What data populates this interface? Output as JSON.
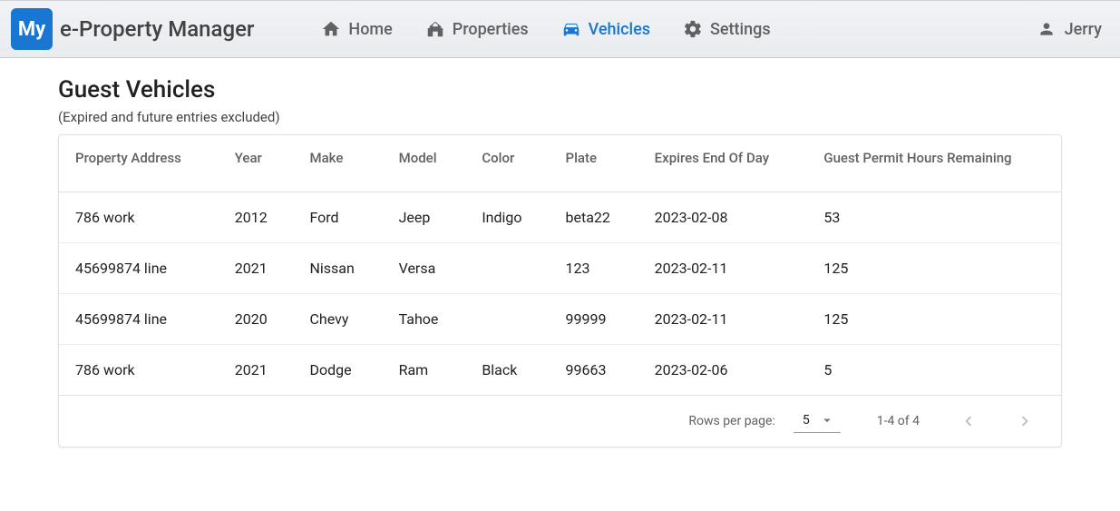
{
  "brand": {
    "logo_text": "My",
    "name": "e-Property Manager"
  },
  "nav": {
    "home": "Home",
    "properties": "Properties",
    "vehicles": "Vehicles",
    "settings": "Settings"
  },
  "user": {
    "name": "Jerry"
  },
  "page": {
    "title": "Guest Vehicles",
    "subtitle": "(Expired and future entries excluded)"
  },
  "table": {
    "headers": {
      "property_address": "Property Address",
      "year": "Year",
      "make": "Make",
      "model": "Model",
      "color": "Color",
      "plate": "Plate",
      "expires": "Expires End Of Day",
      "hours": "Guest Permit Hours Remaining"
    },
    "rows": [
      {
        "property_address": "786 work",
        "year": "2012",
        "make": "Ford",
        "model": "Jeep",
        "color": "Indigo",
        "plate": "beta22",
        "expires": "2023-02-08",
        "hours": "53"
      },
      {
        "property_address": "45699874 line",
        "year": "2021",
        "make": "Nissan",
        "model": "Versa",
        "color": "",
        "plate": "123",
        "expires": "2023-02-11",
        "hours": "125"
      },
      {
        "property_address": "45699874 line",
        "year": "2020",
        "make": "Chevy",
        "model": "Tahoe",
        "color": "",
        "plate": "99999",
        "expires": "2023-02-11",
        "hours": "125"
      },
      {
        "property_address": "786 work",
        "year": "2021",
        "make": "Dodge",
        "model": "Ram",
        "color": "Black",
        "plate": "99663",
        "expires": "2023-02-06",
        "hours": "5"
      }
    ]
  },
  "footer": {
    "rows_per_page_label": "Rows per page:",
    "rows_per_page_value": "5",
    "range": "1-4 of 4"
  }
}
